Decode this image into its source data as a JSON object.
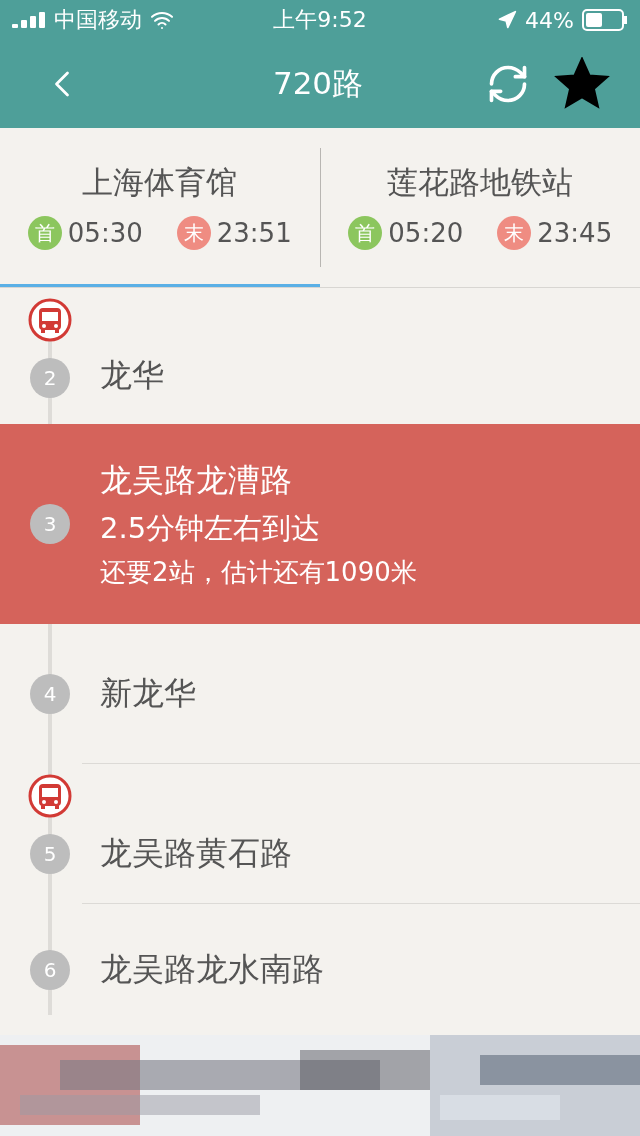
{
  "status_bar": {
    "carrier": "中国移动",
    "time": "上午9:52",
    "battery": "44%"
  },
  "nav": {
    "title": "720路",
    "favorite": true
  },
  "directions": [
    {
      "name": "上海体育馆",
      "first_label": "首",
      "first_time": "05:30",
      "last_label": "末",
      "last_time": "23:51",
      "selected": true
    },
    {
      "name": "莲花路地铁站",
      "first_label": "首",
      "first_time": "05:20",
      "last_label": "末",
      "last_time": "23:45",
      "selected": false
    }
  ],
  "stops": [
    {
      "number": "2",
      "name": "龙华",
      "bus": true,
      "highlighted": false
    },
    {
      "number": "3",
      "name": "龙吴路龙漕路",
      "bus": false,
      "highlighted": true,
      "details": [
        "2.5分钟左右到达",
        "还要2站，估计还有1090米"
      ]
    },
    {
      "number": "4",
      "name": "新龙华",
      "bus": false,
      "highlighted": false
    },
    {
      "number": "5",
      "name": "龙吴路黄石路",
      "bus": true,
      "highlighted": false
    },
    {
      "number": "6",
      "name": "龙吴路龙水南路",
      "bus": false,
      "highlighted": false
    }
  ]
}
